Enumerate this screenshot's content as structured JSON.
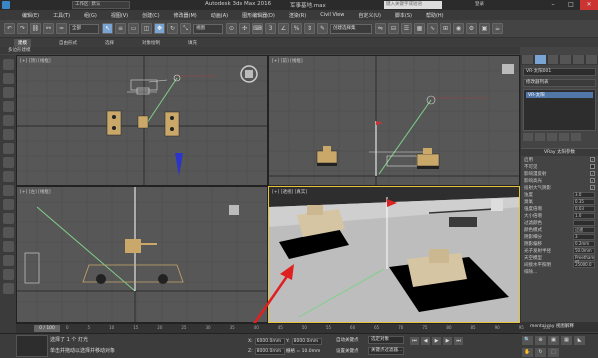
{
  "titlebar": {
    "workspace": "工作区: 默认",
    "app_title": "Autodesk 3ds Max 2016",
    "file_name": "军事基地.max",
    "search_placeholder": "键入关键字或短语",
    "login": "登录"
  },
  "menubar": {
    "items": [
      "编辑(E)",
      "工具(T)",
      "组(G)",
      "视图(V)",
      "创建(C)",
      "修改器(M)",
      "动画(A)",
      "图形编辑器(D)",
      "渲染(R)",
      "Civil View",
      "自定义(U)",
      "脚本(S)",
      "帮助(H)"
    ]
  },
  "toolbar": {
    "selection_filter": "全部",
    "view_dropdown": "视图",
    "named_sel": "创建选择集"
  },
  "ribbon": {
    "tabs": [
      "建模",
      "自由形式",
      "选择",
      "对象绘制",
      "填充"
    ],
    "sub": "多边形建模"
  },
  "viewports": {
    "top": "[+] [顶] [线框]",
    "front": "[+] [前] [线框]",
    "left": "[+] [左] [线框]",
    "persp": "[+] [透视] [真实]"
  },
  "command_panel": {
    "object_name": "VR-太阳001",
    "modifier_list": "修改器列表",
    "stack_item": "VR-太阳",
    "rollout_title": "VRay 太阳参数",
    "params": [
      {
        "label": "启用",
        "type": "check",
        "on": true
      },
      {
        "label": "不可见",
        "type": "check",
        "on": false
      },
      {
        "label": "影响漫反射",
        "type": "check",
        "on": true
      },
      {
        "label": "影响高光",
        "type": "check",
        "on": true
      },
      {
        "label": "投射大气阴影",
        "type": "check",
        "on": true
      },
      {
        "label": "浊度",
        "type": "val",
        "value": "3.0"
      },
      {
        "label": "臭氧",
        "type": "val",
        "value": "0.35"
      },
      {
        "label": "强度倍增",
        "type": "val",
        "value": "0.03"
      },
      {
        "label": "大小倍增",
        "type": "val",
        "value": "1.0"
      },
      {
        "label": "过滤颜色",
        "type": "val",
        "value": ""
      },
      {
        "label": "颜色模式",
        "type": "val",
        "value": "过滤"
      },
      {
        "label": "阴影细分",
        "type": "val",
        "value": "3"
      },
      {
        "label": "阴影偏移",
        "type": "val",
        "value": "0.2mm"
      },
      {
        "label": "光子发射半径",
        "type": "val",
        "value": "50.0mm"
      },
      {
        "label": "天空模型",
        "type": "val",
        "value": "Preetham et"
      },
      {
        "label": "间接水平照明",
        "type": "val",
        "value": "25000.0"
      },
      {
        "label": "排除...",
        "type": "none",
        "value": ""
      }
    ]
  },
  "timeline": {
    "frame": "0 / 100",
    "ticks": [
      "0",
      "5",
      "10",
      "15",
      "20",
      "25",
      "30",
      "35",
      "40",
      "45",
      "50",
      "55",
      "60",
      "65",
      "70",
      "75",
      "80",
      "85",
      "90",
      "95",
      "100"
    ]
  },
  "status": {
    "selected": "选择了 1 个 灯光",
    "hint": "单击并拖动以选择并移动对象",
    "x_label": "X:",
    "x": "6000.0mm",
    "y_label": "Y:",
    "y": "8000.0mm",
    "z_label": "Z:",
    "z": "8000.0mm",
    "grid": "栅格 = 10.0mm",
    "auto_key": "自动关键点",
    "set_key": "设置关键点",
    "sel_obj": "选定对象",
    "key_filter": "关键点过滤器...",
    "add_time_tag": "添加时间标记",
    "mental_ray": "mental ray 视图解释"
  }
}
